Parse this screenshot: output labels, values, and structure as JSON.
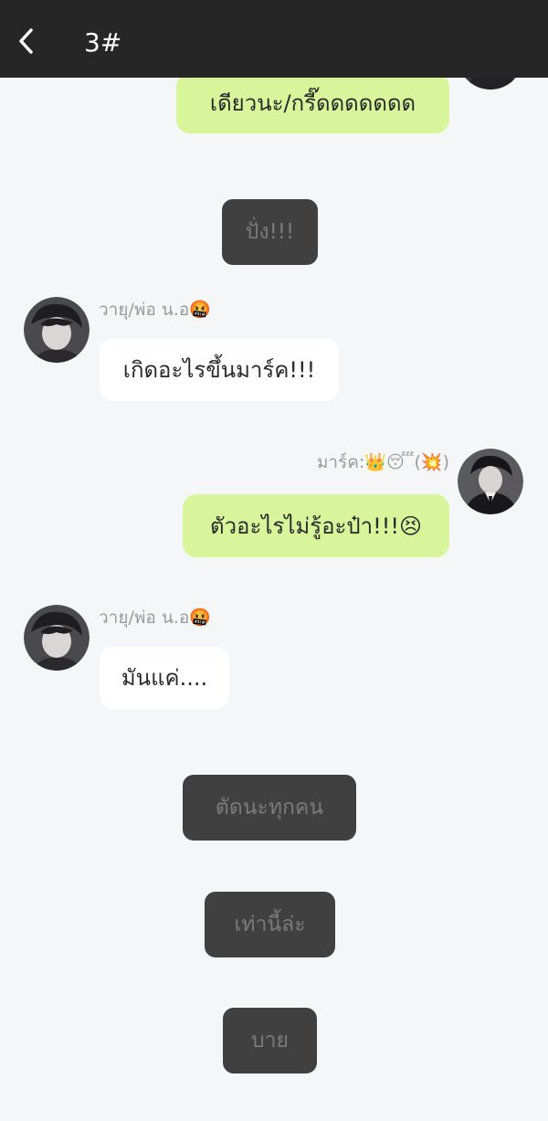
{
  "header": {
    "title": "3#"
  },
  "speakers": {
    "mark": {
      "name": "มาร์ค:👑😴(💥)"
    },
    "wayu": {
      "name": "วายุ/พ่อ น.อ🤬"
    }
  },
  "messages": [
    {
      "kind": "outgoing",
      "text": "เดียวนะ/กรี๊ดดดดดดด"
    },
    {
      "kind": "system",
      "text": "ปั่ง!!!"
    },
    {
      "kind": "incoming",
      "speaker": "วายุ/พ่อ น.อ🤬",
      "text": "เกิดอะไรขึ้นมาร์ค!!!"
    },
    {
      "kind": "outgoing",
      "speaker": "มาร์ค:👑😴(💥)",
      "text": "ตัวอะไรไม่รู้อะป๋า!!!😣"
    },
    {
      "kind": "incoming",
      "speaker": "วายุ/พ่อ น.อ🤬",
      "text": "มันแค่...."
    },
    {
      "kind": "system",
      "text": "ตัดนะทุกคน"
    },
    {
      "kind": "system",
      "text": "เท่านี้ล่ะ"
    },
    {
      "kind": "system",
      "text": "บาย"
    }
  ],
  "colors": {
    "header": "#262626",
    "background": "#f5f6f8",
    "outgoing_bubble": "#d8f59c",
    "incoming_bubble": "#ffffff",
    "system_bubble": "#404040",
    "system_text": "#7b7b7b"
  }
}
